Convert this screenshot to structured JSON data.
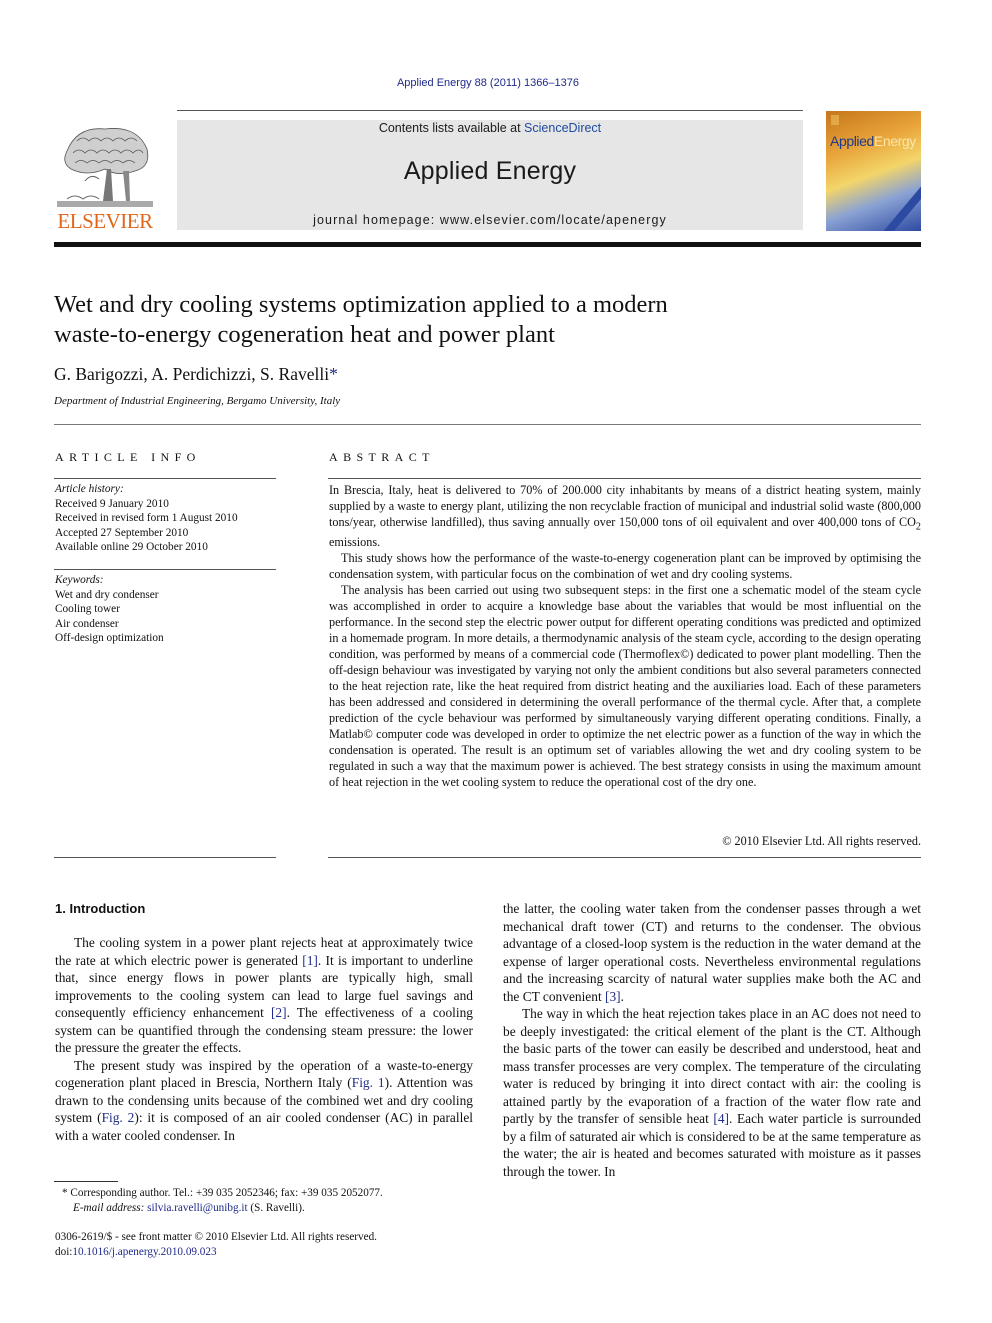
{
  "header": {
    "journal_ref": "Applied Energy 88 (2011) 1366–1376",
    "contents_prefix": "Contents lists available at ",
    "contents_link": "ScienceDirect",
    "journal_name": "Applied Energy",
    "homepage": "journal homepage: www.elsevier.com/locate/apenergy",
    "publisher_logo_text": "ELSEVIER",
    "cover_title_part1": "Applied",
    "cover_title_part2": "Energy"
  },
  "article": {
    "title_line1": "Wet and dry cooling systems optimization applied to a modern",
    "title_line2": "waste-to-energy cogeneration heat and power plant",
    "authors": "G. Barigozzi, A. Perdichizzi, S. Ravelli",
    "corresponding_mark": "*",
    "affiliation": "Department of Industrial Engineering, Bergamo University, Italy"
  },
  "article_info": {
    "heading": "ARTICLE INFO",
    "history_label": "Article history:",
    "history": [
      "Received 9 January 2010",
      "Received in revised form 1 August 2010",
      "Accepted 27 September 2010",
      "Available online 29 October 2010"
    ],
    "keywords_label": "Keywords:",
    "keywords": [
      "Wet and dry condenser",
      "Cooling tower",
      "Air condenser",
      "Off-design optimization"
    ]
  },
  "abstract": {
    "heading": "ABSTRACT",
    "p1_a": "In Brescia, Italy, heat is delivered to 70% of 200.000 city inhabitants by means of a district heating system, mainly supplied by a waste to energy plant, utilizing the non recyclable fraction of municipal and industrial solid waste (800,000 tons/year, otherwise landfilled), thus saving annually over 150,000 tons of oil equivalent and over 400,000 tons of CO",
    "p1_sub": "2",
    "p1_b": " emissions.",
    "p2": "This study shows how the performance of the waste-to-energy cogeneration plant can be improved by optimising the condensation system, with particular focus on the combination of wet and dry cooling systems.",
    "p3": "The analysis has been carried out using two subsequent steps: in the first one a schematic model of the steam cycle was accomplished in order to acquire a knowledge base about the variables that would be most influential on the performance. In the second step the electric power output for different operating conditions was predicted and optimized in a homemade program. In more details, a thermodynamic analysis of the steam cycle, according to the design operating condition, was performed by means of a commercial code (Thermoflex©) dedicated to power plant modelling. Then the off-design behaviour was investigated by varying not only the ambient conditions but also several parameters connected to the heat rejection rate, like the heat required from district heating and the auxiliaries load. Each of these parameters has been addressed and considered in determining the overall performance of the thermal cycle. After that, a complete prediction of the cycle behaviour was performed by simultaneously varying different operating conditions. Finally, a Matlab© computer code was developed in order to optimize the net electric power as a function of the way in which the condensation is operated. The result is an optimum set of variables allowing the wet and dry cooling system to be regulated in such a way that the maximum power is achieved. The best strategy consists in using the maximum amount of heat rejection in the wet cooling system to reduce the operational cost of the dry one.",
    "copyright": "© 2010 Elsevier Ltd. All rights reserved."
  },
  "body": {
    "section_heading": "1. Introduction",
    "left_p1_a": "The cooling system in a power plant rejects heat at approximately twice the rate at which electric power is generated ",
    "ref1": "[1]",
    "left_p1_b": ". It is important to underline that, since energy flows in power plants are typically high, small improvements to the cooling system can lead to large fuel savings and consequently efficiency enhancement ",
    "ref2": "[2]",
    "left_p1_c": ". The effectiveness of a cooling system can be quantified through the condensing steam pressure: the lower the pressure the greater the effects.",
    "left_p2_a": "The present study was inspired by the operation of a waste-to-energy cogeneration plant placed in Brescia, Northern Italy (",
    "fig1": "Fig. 1",
    "left_p2_b": "). Attention was drawn to the condensing units because of the combined wet and dry cooling system (",
    "fig2": "Fig. 2",
    "left_p2_c": "): it is composed of an air cooled condenser (AC) in parallel with a water cooled condenser. In",
    "right_p1_a": "the latter, the cooling water taken from the condenser passes through a wet mechanical draft tower (CT) and returns to the condenser. The obvious advantage of a closed-loop system is the reduction in the water demand at the expense of larger operational costs. Nevertheless environmental regulations and the increasing scarcity of natural water supplies make both the AC and the CT convenient ",
    "ref3": "[3]",
    "right_p1_b": ".",
    "right_p2_a": "The way in which the heat rejection takes place in an AC does not need to be deeply investigated: the critical element of the plant is the CT. Although the basic parts of the tower can easily be described and understood, heat and mass transfer processes are very complex. The temperature of the circulating water is reduced by bringing it into direct contact with air: the cooling is attained partly by the evaporation of a fraction of the water flow rate and partly by the transfer of sensible heat ",
    "ref4": "[4]",
    "right_p2_b": ". Each water particle is surrounded by a film of saturated air which is considered to be at the same temperature as the water; the air is heated and becomes saturated with moisture as it passes through the tower. In"
  },
  "footnote": {
    "mark": "*",
    "contact": " Corresponding author. Tel.: +39 035 2052346; fax: +39 035 2052077.",
    "email_label": "E-mail address:",
    "email": "silvia.ravelli@unibg.it",
    "email_suffix": " (S. Ravelli)."
  },
  "front_matter": {
    "issn_line": "0306-2619/$ - see front matter © 2010 Elsevier Ltd. All rights reserved.",
    "doi_prefix": "doi:",
    "doi": "10.1016/j.apenergy.2010.09.023"
  },
  "colors": {
    "link": "#1f2a8a",
    "elsevier_orange": "#e0661c",
    "masthead_gray": "#e6e6e6"
  }
}
